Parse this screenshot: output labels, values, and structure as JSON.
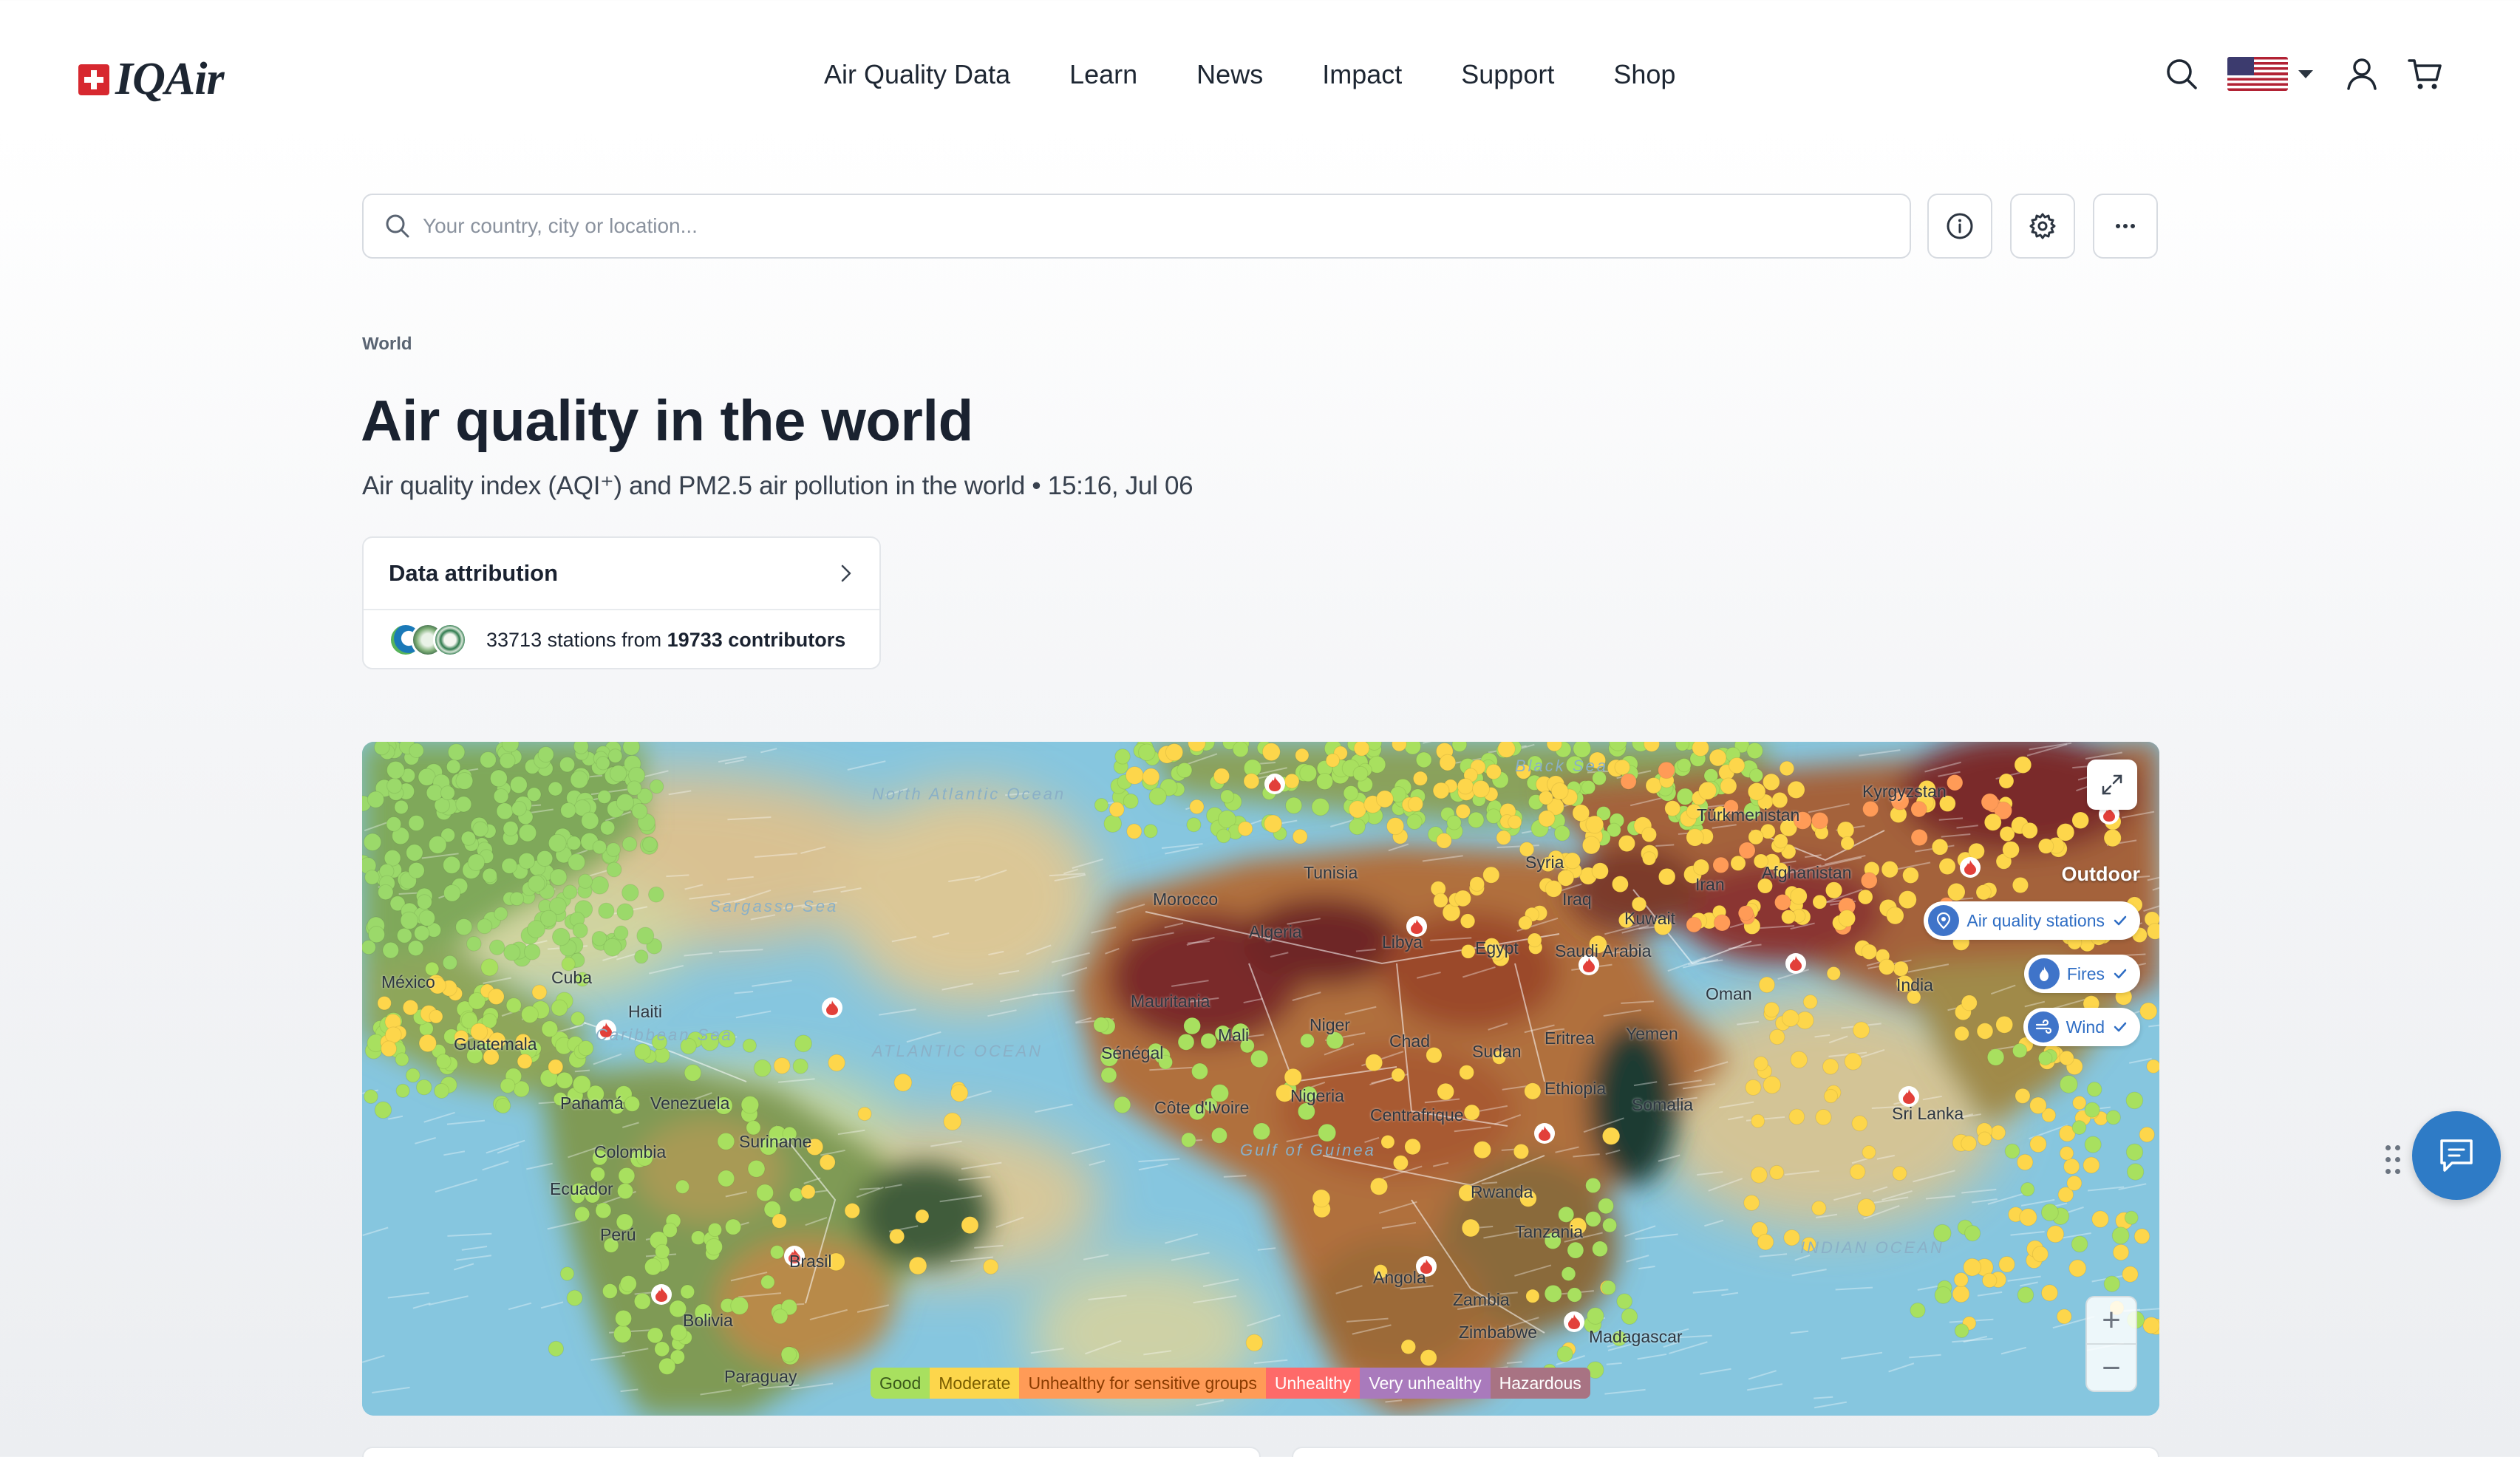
{
  "header": {
    "logo_text": "IQAir",
    "nav": [
      "Air Quality Data",
      "Learn",
      "News",
      "Impact",
      "Support",
      "Shop"
    ],
    "icons": [
      "search-icon",
      "us-flag-icon",
      "user-icon",
      "cart-icon"
    ]
  },
  "search": {
    "placeholder": "Your country, city or location...",
    "value": ""
  },
  "toolbar_buttons": [
    "info-icon",
    "gear-icon",
    "more-icon"
  ],
  "breadcrumb": "World",
  "page": {
    "title": "Air quality in the world",
    "subtitle": "Air quality index (AQI⁺) and PM2.5 air pollution in the world • 15:16, Jul 06"
  },
  "attribution": {
    "title": "Data attribution",
    "stations": "33713",
    "stations_text": " stations from ",
    "contributors": "19733 contributors"
  },
  "map": {
    "outdoor_label": "Outdoor",
    "layers": [
      {
        "label": "Air quality stations",
        "icon": "location-pin-icon",
        "checked": true
      },
      {
        "label": "Fires",
        "icon": "fire-icon",
        "checked": true
      },
      {
        "label": "Wind",
        "icon": "wind-icon",
        "checked": true
      }
    ],
    "zoom_in": "+",
    "zoom_out": "−",
    "labels": {
      "north_atlantic": "North Atlantic Ocean",
      "sargasso": "Sargasso Sea",
      "atlantic": "ATLANTIC OCEAN",
      "caribbean": "Caribbean Sea",
      "gulf_guinea": "Gulf of Guinea",
      "indian": "INDIAN OCEAN",
      "black_sea": "Black Sea",
      "mexico": "México",
      "cuba": "Cuba",
      "haiti": "Haiti",
      "guatemala": "Guatemala",
      "panama": "Panamá",
      "venezuela": "Venezuela",
      "suriname": "Suriname",
      "colombia": "Colombia",
      "ecuador": "Ecuador",
      "peru": "Perú",
      "brasil": "Brasil",
      "bolivia": "Bolivia",
      "paraguay": "Paraguay",
      "morocco": "Morocco",
      "tunisia": "Tunisia",
      "algeria": "Algeria",
      "libya": "Libya",
      "egypt": "Egypt",
      "mauritania": "Mauritania",
      "mali": "Mali",
      "niger": "Niger",
      "chad": "Chad",
      "sudan": "Sudan",
      "senegal": "Sénégal",
      "cote": "Côte d'Ivoire",
      "nigeria": "Nigeria",
      "centrafrique": "Centrafrique",
      "ethiopia": "Ethiopia",
      "eritrea": "Eritrea",
      "yemen": "Yemen",
      "somalia": "Somalia",
      "rwanda": "Rwanda",
      "tanzania": "Tanzania",
      "angola": "Angola",
      "zambia": "Zambia",
      "zimbabwe": "Zimbabwe",
      "madagascar": "Madagascar",
      "syria": "Syria",
      "iraq": "Iraq",
      "iran": "Iran",
      "kuwait": "Kuwait",
      "saudi": "Saudi Arabia",
      "oman": "Oman",
      "turkmenistan": "Türkmenistan",
      "afghanistan": "Afghanistan",
      "kyrgyzstan": "Kyrgyzstan",
      "india": "India",
      "sri_lanka": "Sri Lanka"
    }
  },
  "legend": [
    {
      "label": "Good",
      "bg": "#a8e05f",
      "fg": "#3b5a1b"
    },
    {
      "label": "Moderate",
      "bg": "#fdd64b",
      "fg": "#7a5d00"
    },
    {
      "label": "Unhealthy for sensitive groups",
      "bg": "#ff9b57",
      "fg": "#8a3b00"
    },
    {
      "label": "Unhealthy",
      "bg": "#fe6a69",
      "fg": "#ffffff"
    },
    {
      "label": "Very unhealthy",
      "bg": "#a97abc",
      "fg": "#ffffff"
    },
    {
      "label": "Hazardous",
      "bg": "#a87383",
      "fg": "#ffffff"
    }
  ],
  "colors": {
    "brand_red": "#d7282f",
    "accent_blue": "#2e7bc6",
    "text_dark": "#1a2230"
  }
}
